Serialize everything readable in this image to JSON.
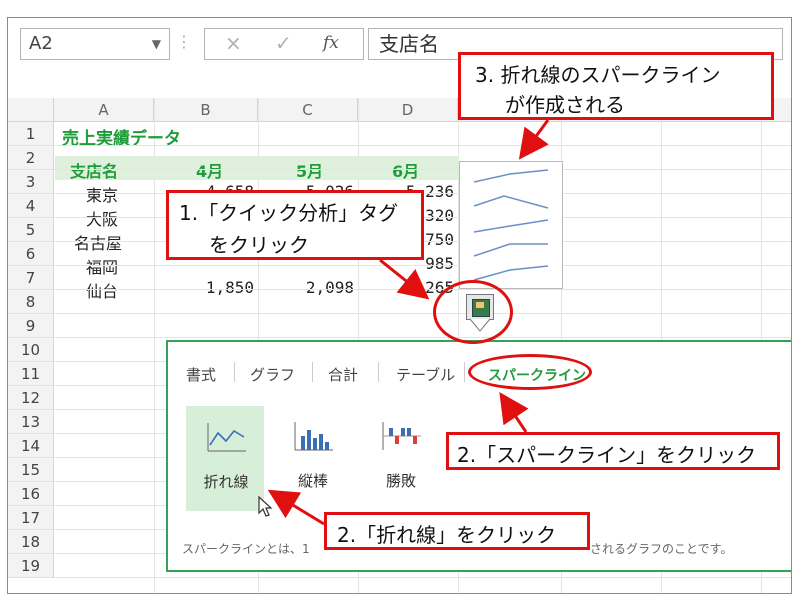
{
  "formula_bar": {
    "name_box": "A2",
    "cancel_glyph": "×",
    "enter_glyph": "✓",
    "fx_glyph": "fx",
    "content": "支店名"
  },
  "columns": [
    "A",
    "B",
    "C",
    "D"
  ],
  "rows": [
    "1",
    "2",
    "3",
    "4",
    "5",
    "6",
    "7",
    "8",
    "9",
    "10",
    "11",
    "12",
    "13",
    "14",
    "15",
    "16",
    "17",
    "18",
    "19"
  ],
  "sheet": {
    "title": "売上実績データ",
    "headers": [
      "支店名",
      "4月",
      "5月",
      "6月"
    ],
    "data": [
      {
        "branch": "東京",
        "apr": "4,658",
        "may": "5,026",
        "jun": "5,236"
      },
      {
        "branch": "大阪",
        "apr": "",
        "may": "",
        "jun": "320"
      },
      {
        "branch": "名古屋",
        "apr": "",
        "may": "",
        "jun": "750"
      },
      {
        "branch": "福岡",
        "apr": "",
        "may": "",
        "jun": "985"
      },
      {
        "branch": "仙台",
        "apr": "1,850",
        "may": "2,098",
        "jun": "2,265"
      }
    ]
  },
  "quick_analysis": {
    "button_icon": "quick-analysis-icon",
    "tabs": [
      "書式",
      "グラフ",
      "合計",
      "テーブル",
      "スパークライン"
    ],
    "options": [
      {
        "label": "折れ線",
        "icon": "sparkline-line-icon"
      },
      {
        "label": "縦棒",
        "icon": "sparkline-column-icon"
      },
      {
        "label": "勝敗",
        "icon": "sparkline-winloss-icon"
      }
    ],
    "note_left": "スパークラインとは、1",
    "note_right": "されるグラフのことです。"
  },
  "callouts": {
    "step1_line1": "1.「クイック分析」タグ",
    "step1_line2": "をクリック",
    "step2a": "2.「スパークライン」をクリック",
    "step2b": "2.「折れ線」をクリック",
    "step3_line1": "3. 折れ線のスパークライン",
    "step3_line2": "が作成される"
  },
  "colors": {
    "accent_red": "#e01010",
    "excel_green": "#1f9c3a",
    "sparkline_blue": "#6a8fc8"
  }
}
